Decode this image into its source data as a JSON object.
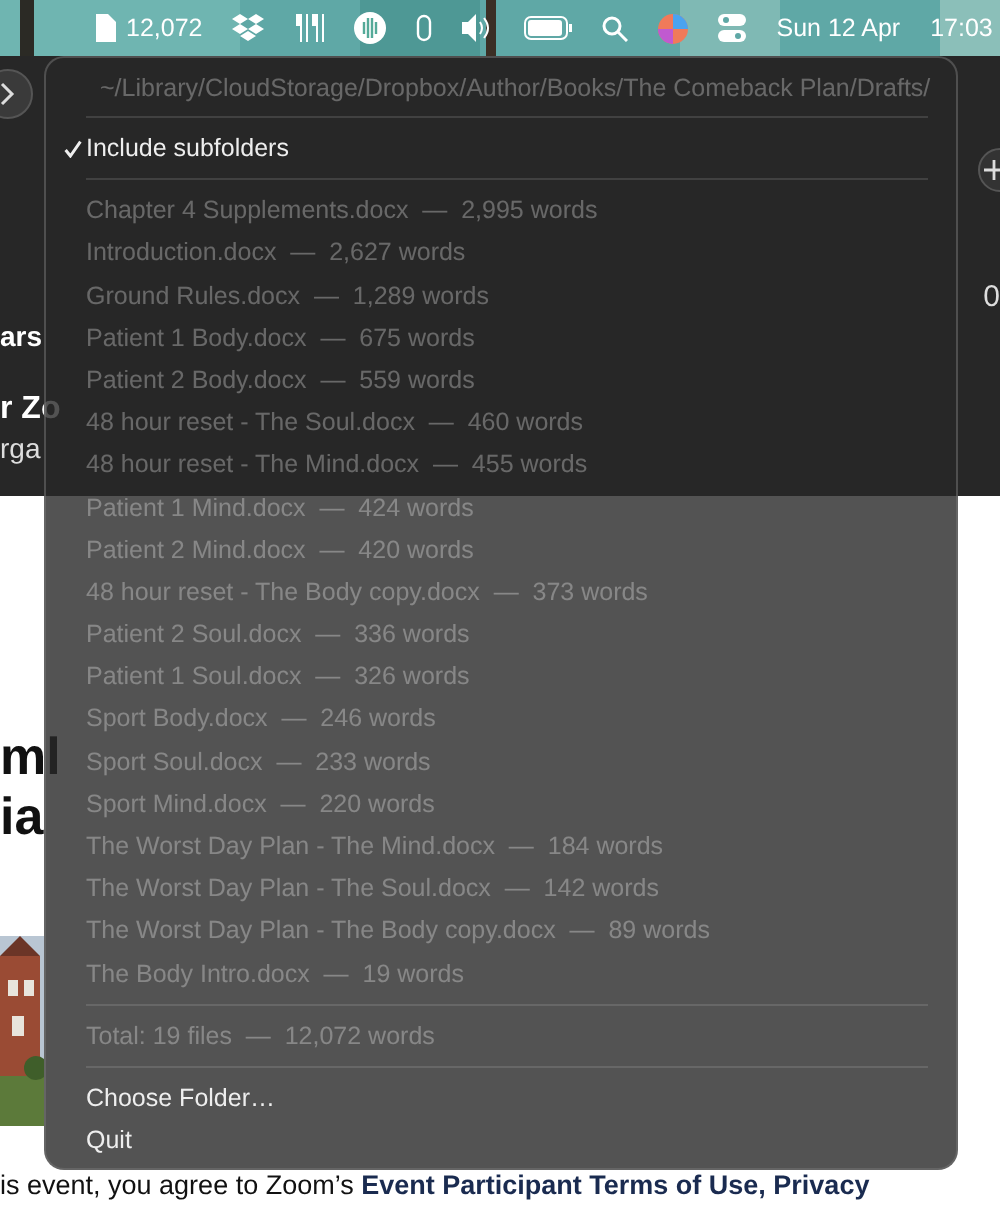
{
  "menu_bar": {
    "word_count": "12,072",
    "date": "Sun 12 Apr",
    "time": "17:03"
  },
  "background_page": {
    "header_fragments": [
      "ars",
      "r Zo",
      "rga"
    ],
    "right_fragment": "0",
    "heading_fragments": [
      "ml",
      "ia"
    ],
    "footer_text": "is event, you agree to Zoom’s **Event Participant Terms of Use, Privacy**"
  },
  "menu": {
    "path": "~/Library/CloudStorage/Dropbox/Author/Books/The Comeback Plan/Drafts/",
    "options": [
      {
        "label": "Include subfolders",
        "checked": true
      }
    ],
    "files": [
      {
        "label": "Chapter 4 Supplements.docx  —  2,995 words",
        "disabled": true
      },
      {
        "label": "Introduction.docx  —  2,627 words",
        "disabled": true
      },
      {
        "label": "Ground Rules.docx  —  1,289 words",
        "disabled": true
      },
      {
        "label": "Patient 1 Body.docx  —  675 words",
        "disabled": true
      },
      {
        "label": "Patient 2 Body.docx  —  559 words",
        "disabled": true
      },
      {
        "label": "48 hour reset - The Soul.docx  —  460 words",
        "disabled": true
      },
      {
        "label": "48 hour reset - The Mind.docx  —  455 words",
        "disabled": true
      },
      {
        "label": "Patient 1 Mind.docx  —  424 words",
        "disabled": true
      },
      {
        "label": "Patient 2 Mind.docx  —  420 words",
        "disabled": true
      },
      {
        "label": "48 hour reset - The Body copy.docx  —  373 words",
        "disabled": true
      },
      {
        "label": "Patient 2 Soul.docx  —  336 words",
        "disabled": true
      },
      {
        "label": "Patient 1 Soul.docx  —  326 words",
        "disabled": true
      },
      {
        "label": "Sport Body.docx  —  246 words",
        "disabled": true
      },
      {
        "label": "Sport Soul.docx  —  233 words",
        "disabled": true
      },
      {
        "label": "Sport Mind.docx  —  220 words",
        "disabled": true
      },
      {
        "label": "The Worst Day Plan - The Mind.docx  —  184 words",
        "disabled": true
      },
      {
        "label": "The Worst Day Plan - The Soul.docx  —  142 words",
        "disabled": true
      },
      {
        "label": "The Worst Day Plan - The Body copy.docx  —  89 words",
        "disabled": true
      },
      {
        "label": "The Body Intro.docx  —  19 words",
        "disabled": true
      }
    ],
    "total": {
      "label": "Total: 19 files  —  12,072 words",
      "disabled": true
    },
    "actions": [
      {
        "label": "Choose Folder…",
        "disabled": false
      },
      {
        "label": "Quit",
        "disabled": false
      }
    ]
  }
}
